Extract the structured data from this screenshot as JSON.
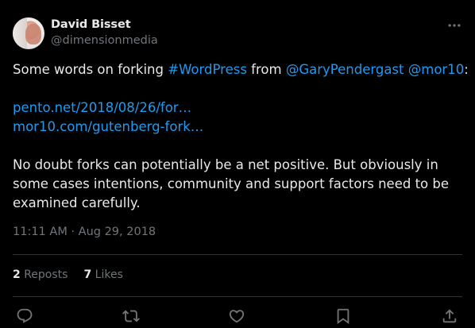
{
  "author": {
    "display_name": "David Bisset",
    "handle": "@dimensionmedia"
  },
  "tweet": {
    "line1_prefix": "Some words on forking ",
    "hashtag": "#WordPress",
    "from_word": " from ",
    "mention1": "@GaryPendergast",
    "mention2": "@mor10",
    "colon": ":",
    "url1": "pento.net/2018/08/26/for…",
    "url2": "mor10.com/gutenberg-fork…",
    "paragraph2": "No doubt forks can potentially be a net positive. But obviously in some cases intentions, community and support factors need to be examined carefully.",
    "timestamp": "11:11 AM · Aug 29, 2018"
  },
  "stats": {
    "reposts_count": "2",
    "reposts_label": "Reposts",
    "likes_count": "7",
    "likes_label": "Likes"
  },
  "icons": {
    "more": "more-icon",
    "reply": "reply-icon",
    "repost": "repost-icon",
    "like": "like-icon",
    "bookmark": "bookmark-icon",
    "share": "share-icon"
  },
  "colors": {
    "background": "#000000",
    "text": "#e7e9ea",
    "muted": "#71767b",
    "link": "#1d9bf0",
    "divider": "#2f3336"
  }
}
